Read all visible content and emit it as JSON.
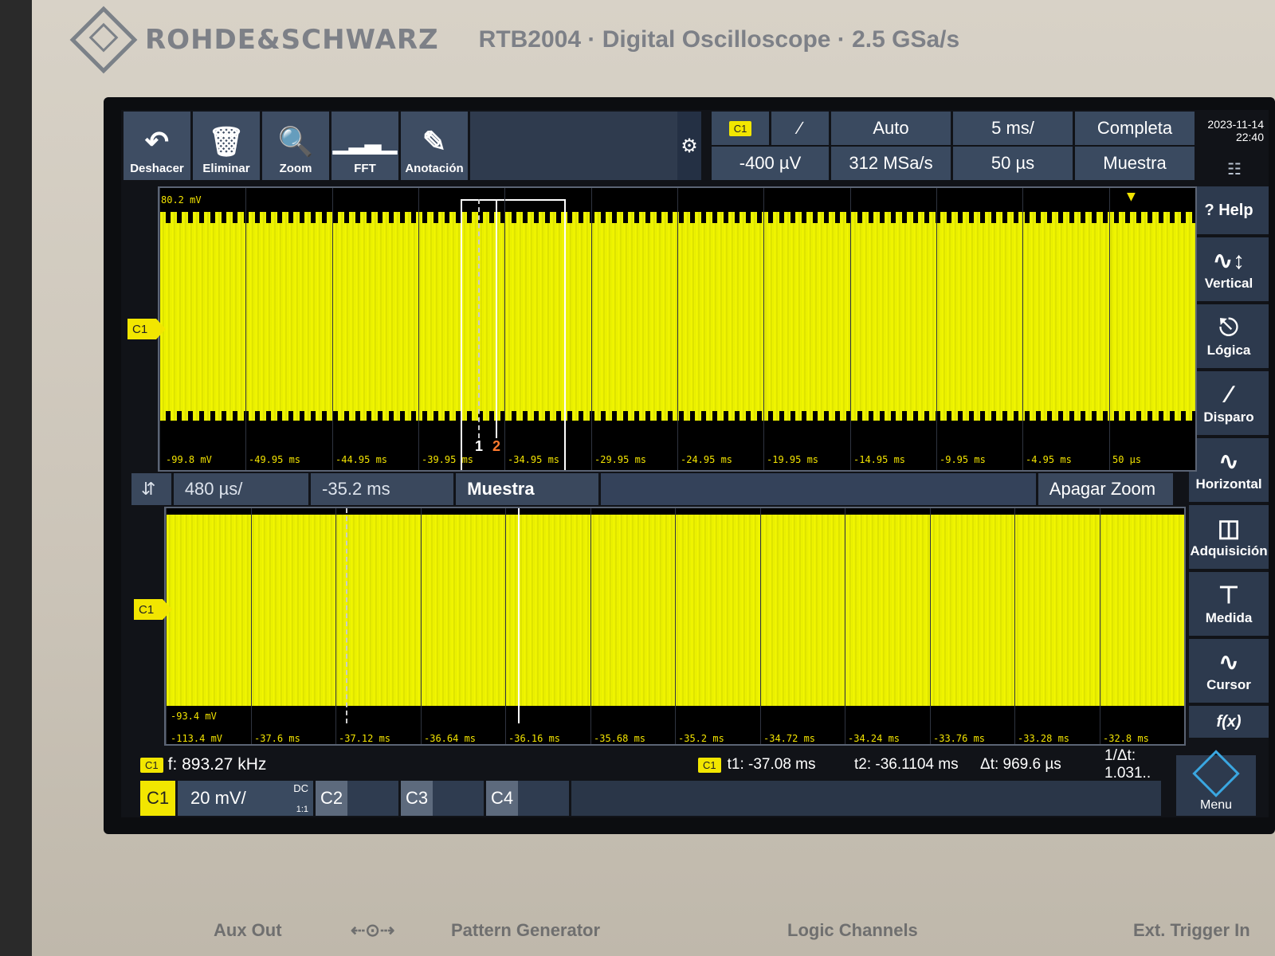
{
  "brand": {
    "name": "ROHDE&SCHWARZ",
    "model": "RTB2004 · Digital Oscilloscope · 2.5 GSa/s"
  },
  "toolbar": {
    "undo_label": "Deshacer",
    "delete_label": "Eliminar",
    "zoom_label": "Zoom",
    "fft_label": "FFT",
    "annotation_label": "Anotación"
  },
  "status": {
    "channel_badge": "C1",
    "trigger_slope": "∕",
    "trigger_mode": "Auto",
    "trigger_level": "-400 µV",
    "sample_rate": "312 MSa/s",
    "time_scale": "5 ms/",
    "time_offset": "50 µs",
    "record": "Completa",
    "acq_mode": "Muestra",
    "date": "2023-11-14",
    "time": "22:40"
  },
  "side_menu": {
    "help": "Help",
    "vertical": "Vertical",
    "logic": "Lógica",
    "trigger": "Disparo",
    "horizontal": "Horizontal",
    "acquisition": "Adquisición",
    "measure": "Medida",
    "cursor": "Cursor",
    "fx": "f(x)",
    "menu": "Menu"
  },
  "main_pane": {
    "channel_marker": "C1",
    "vmax": "80.2 mV",
    "vmin": "-99.8 mV",
    "time_ticks": [
      "-49.95 ms",
      "-44.95 ms",
      "-39.95 ms",
      "-34.95 ms",
      "-29.95 ms",
      "-24.95 ms",
      "-19.95 ms",
      "-14.95 ms",
      "-9.95 ms",
      "-4.95 ms",
      "50 µs"
    ],
    "cursor1": "1",
    "cursor2": "2"
  },
  "zoom_bar": {
    "time_scale": "480 µs/",
    "position": "-35.2 ms",
    "mode": "Muestra",
    "off_label": "Apagar Zoom"
  },
  "zoom_pane": {
    "channel_marker": "C1",
    "vmin_upper": "-93.4 mV",
    "vmin": "-113.4 mV",
    "time_ticks": [
      "-37.6 ms",
      "-37.12 ms",
      "-36.64 ms",
      "-36.16 ms",
      "-35.68 ms",
      "-35.2 ms",
      "-34.72 ms",
      "-34.24 ms",
      "-33.76 ms",
      "-33.28 ms",
      "-32.8 ms"
    ]
  },
  "measurements": {
    "freq_badge": "C1",
    "frequency": "f: 893.27 kHz",
    "cursor_badge": "C1",
    "t1": "t1: -37.08 ms",
    "t2": "t2: -36.1104 ms",
    "dt": "Δt: 969.6 µs",
    "inv_dt": "1/Δt: 1.031.."
  },
  "channels": {
    "c1": "C1",
    "c1_scale": "20 mV/",
    "c1_coupling": "DC",
    "c1_probe": "1:1",
    "c2": "C2",
    "c3": "C3",
    "c4": "C4"
  },
  "ports": {
    "aux_out": "Aux Out",
    "usb": "⇠⊙⇢",
    "pattern": "Pattern Generator",
    "logic": "Logic Channels",
    "ext_trigger": "Ext. Trigger In"
  },
  "colors": {
    "trace": "#f2f400",
    "panel": "#3a4a60",
    "badge": "#f2e600",
    "cursor2": "#ff7a2e"
  }
}
